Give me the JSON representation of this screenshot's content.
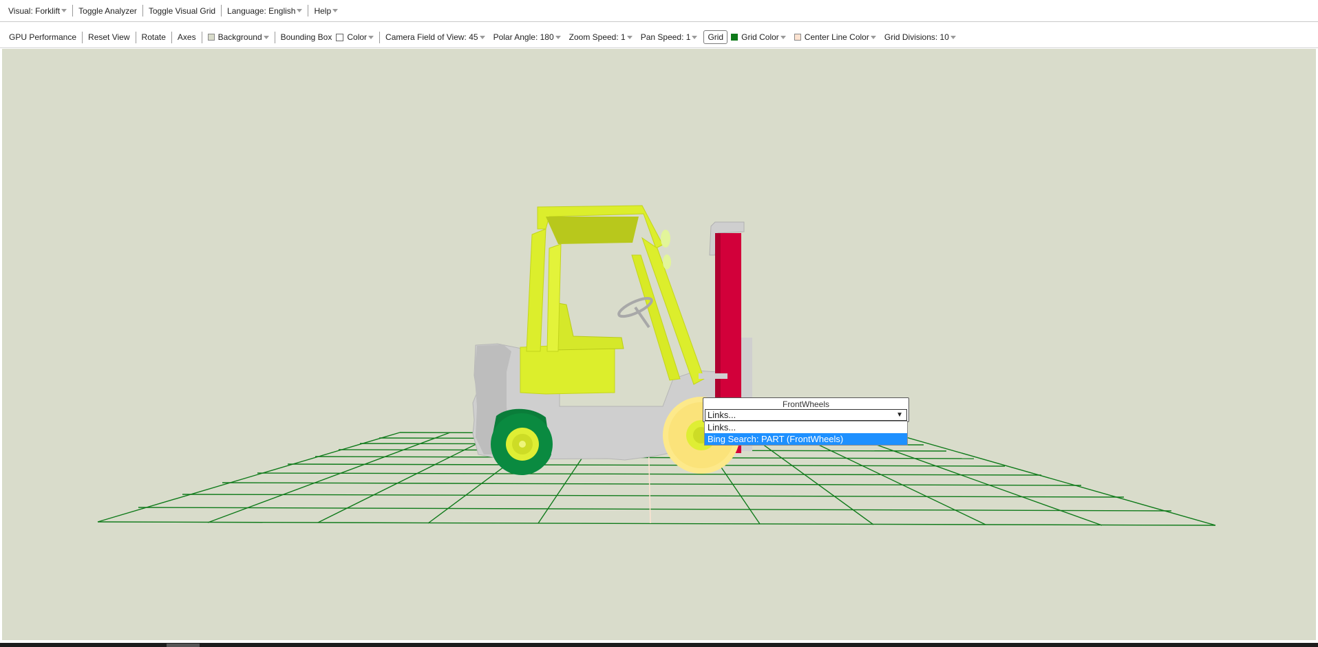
{
  "menubar": {
    "items": [
      {
        "label": "Visual: Forklift",
        "dropdown": true
      },
      {
        "label": "Toggle Analyzer",
        "dropdown": false
      },
      {
        "label": "Toggle Visual Grid",
        "dropdown": false
      },
      {
        "label": "Language: English",
        "dropdown": true
      },
      {
        "label": "Help",
        "dropdown": true
      }
    ]
  },
  "toolbar": {
    "gpu_performance": "GPU Performance",
    "reset_view": "Reset View",
    "rotate": "Rotate",
    "axes": "Axes",
    "background": "Background",
    "bounding_box": "Bounding Box",
    "color": "Color",
    "camera_fov": "Camera Field of View: 45",
    "polar_angle": "Polar Angle: 180",
    "zoom_speed": "Zoom Speed: 1",
    "pan_speed": "Pan Speed: 1",
    "grid": "Grid",
    "grid_color": "Grid Color",
    "center_line_color": "Center Line Color",
    "grid_divisions": "Grid Divisions: 10"
  },
  "colors": {
    "background_swatch": "#d9dccb",
    "grid_color_swatch": "#0f7a1a",
    "center_line_color_swatch": "#fde3d1",
    "viewport_bg": "#d9dccb",
    "forklift_body": "#dcee2c",
    "forklift_chassis": "#cfcfcf",
    "mast": "#d2003a",
    "rear_wheel": "#0a7d3a",
    "front_wheel_highlight": "#fde98a"
  },
  "popup": {
    "title": "FrontWheels",
    "select_value": "Links...",
    "options": [
      "Links...",
      "Bing Search: PART (FrontWheels)"
    ],
    "selected_option_index": 1
  }
}
